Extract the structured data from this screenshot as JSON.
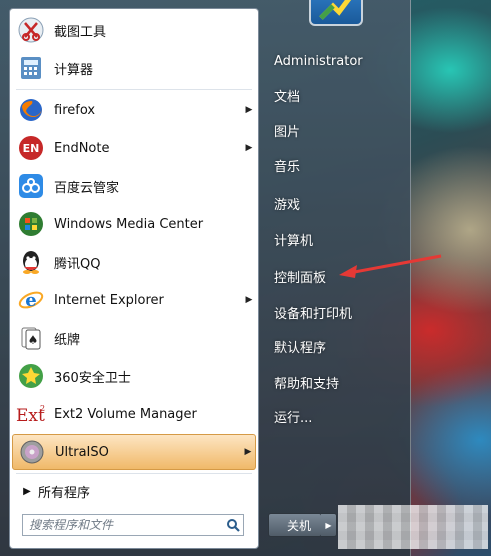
{
  "left_pane": {
    "programs": [
      {
        "label": "截图工具",
        "icon": "snipping-tool-icon",
        "has_submenu": false
      },
      {
        "label": "计算器",
        "icon": "calculator-icon",
        "has_submenu": false
      },
      {
        "label": "firefox",
        "icon": "firefox-icon",
        "has_submenu": true
      },
      {
        "label": "EndNote",
        "icon": "endnote-icon",
        "has_submenu": true
      },
      {
        "label": "百度云管家",
        "icon": "baidu-cloud-icon",
        "has_submenu": false
      },
      {
        "label": "Windows Media Center",
        "icon": "windows-media-center-icon",
        "has_submenu": false
      },
      {
        "label": "腾讯QQ",
        "icon": "qq-icon",
        "has_submenu": false
      },
      {
        "label": "Internet Explorer",
        "icon": "internet-explorer-icon",
        "has_submenu": true
      },
      {
        "label": "纸牌",
        "icon": "solitaire-icon",
        "has_submenu": false
      },
      {
        "label": "360安全卫士",
        "icon": "360-security-icon",
        "has_submenu": false
      },
      {
        "label": "Ext2 Volume Manager",
        "icon": "ext2-icon",
        "has_submenu": false
      },
      {
        "label": "UltraISO",
        "icon": "ultraiso-icon",
        "has_submenu": true,
        "highlighted": true
      }
    ],
    "all_programs": "所有程序",
    "search_placeholder": "搜索程序和文件"
  },
  "right_pane": {
    "items": [
      {
        "label": "Administrator"
      },
      {
        "label": "文档"
      },
      {
        "label": "图片"
      },
      {
        "label": "音乐"
      },
      {
        "label": "游戏"
      },
      {
        "label": "计算机"
      },
      {
        "label": "控制面板"
      },
      {
        "label": "设备和打印机"
      },
      {
        "label": "默认程序"
      },
      {
        "label": "帮助和支持"
      },
      {
        "label": "运行..."
      }
    ],
    "shutdown_label": "关机"
  },
  "colors": {
    "highlight": "#f0b969",
    "annotation_arrow": "#e53935"
  }
}
